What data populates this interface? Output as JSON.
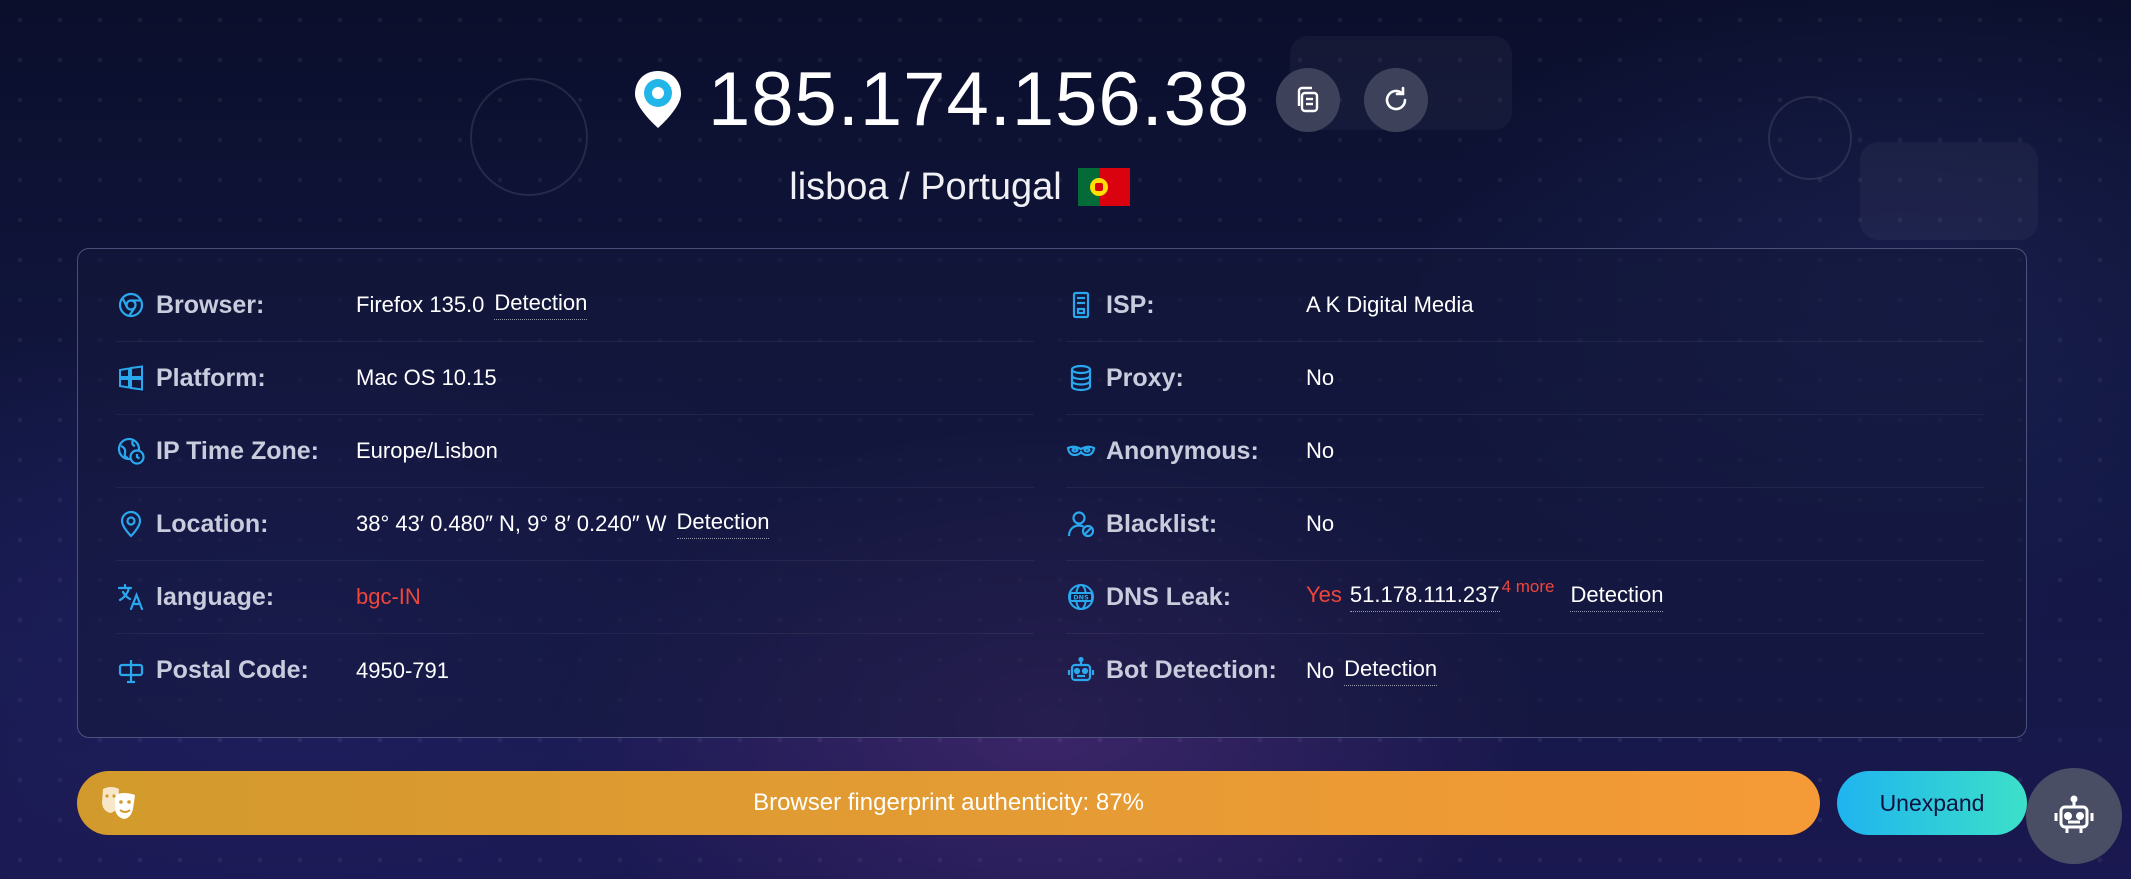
{
  "header": {
    "ip": "185.174.156.38",
    "location": "lisboa / Portugal",
    "flag_icon": "portugal-flag",
    "pin_icon": "location-pin-icon",
    "copy_icon": "copy-icon",
    "refresh_icon": "refresh-icon"
  },
  "info": {
    "left": [
      {
        "label": "Browser:",
        "value": "Firefox 135.0",
        "link": "Detection",
        "icon": "browser-icon"
      },
      {
        "label": "Platform:",
        "value": "Mac OS 10.15",
        "icon": "windows-icon"
      },
      {
        "label": "IP Time Zone:",
        "value": "Europe/Lisbon",
        "icon": "timezone-icon"
      },
      {
        "label": "Location:",
        "value": "38° 43′ 0.480″ N, 9° 8′ 0.240″ W",
        "link": "Detection",
        "icon": "location-icon"
      },
      {
        "label": "language:",
        "value": "bgc-IN",
        "icon": "language-icon"
      },
      {
        "label": "Postal Code:",
        "value": "4950-791",
        "icon": "postal-code-icon"
      }
    ],
    "right": [
      {
        "label": "ISP:",
        "value": "A K Digital Media",
        "icon": "isp-icon"
      },
      {
        "label": "Proxy:",
        "value": "No",
        "icon": "database-icon"
      },
      {
        "label": "Anonymous:",
        "value": "No",
        "icon": "mask-icon"
      },
      {
        "label": "Blacklist:",
        "value": "No",
        "icon": "user-block-icon"
      },
      {
        "label": "DNS Leak:",
        "value": "Yes",
        "dns_ip": "51.178.111.237",
        "more": "4 more",
        "link": "Detection",
        "icon": "dns-icon"
      },
      {
        "label": "Bot Detection:",
        "value": "No",
        "link": "Detection",
        "icon": "robot-icon"
      }
    ]
  },
  "footer": {
    "authenticity_text": "Browser fingerprint authenticity: 87%",
    "authenticity_percent": 87,
    "unexpand_label": "Unexpand",
    "mask_icon": "theater-mask-icon",
    "bot_icon": "robot-icon"
  },
  "colors": {
    "accent": "#1fb4ef",
    "icon_blue": "#2aa8ee",
    "warning_red": "#f0453b",
    "bar_start": "#d29a2c",
    "bar_end": "#f59a36"
  }
}
